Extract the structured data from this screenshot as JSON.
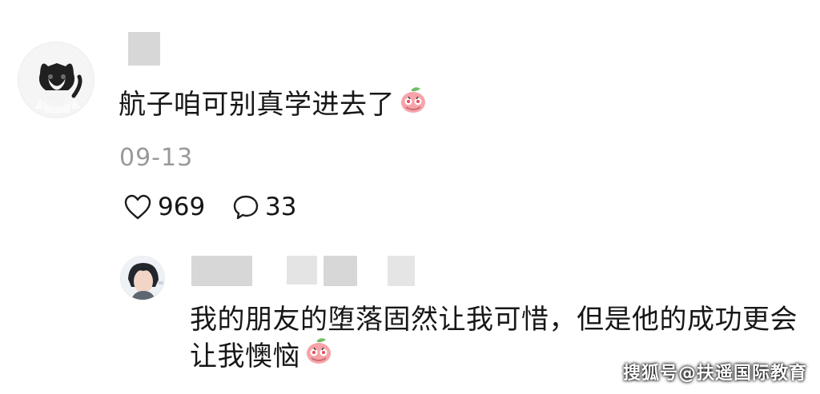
{
  "comment": {
    "avatar_icon": "black-white-cat-icon",
    "username_visible": false,
    "text": "航子咱可别真学进去了",
    "emoji": "peach-shy-emoji",
    "date": "09-13",
    "likes": "969",
    "replies": "33"
  },
  "reply": {
    "avatar_icon": "user-avatar-icon",
    "username_visible": false,
    "text": "我的朋友的堕落固然让我可惜，但是他的成功更会让我懊恼",
    "emoji": "peach-shy-emoji"
  },
  "watermark": {
    "text": "搜狐号@扶遥国际教育"
  },
  "colors": {
    "background": "#ffffff",
    "text_primary": "#171717",
    "text_secondary": "#999999"
  }
}
